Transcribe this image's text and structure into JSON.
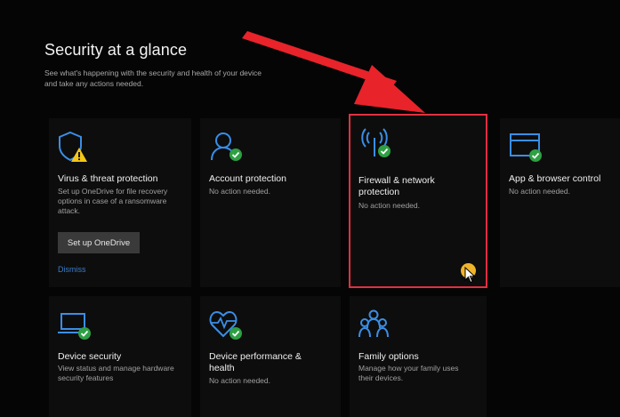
{
  "header": {
    "title": "Security at a glance",
    "subtitle_line1": "See what's happening with the security and health of your device",
    "subtitle_line2": "and take any actions needed."
  },
  "tiles": [
    {
      "icon": "shield-warning-icon",
      "title": "Virus & threat protection",
      "desc": "Set up OneDrive for file recovery options in case of a ransomware attack.",
      "button_label": "Set up OneDrive",
      "dismiss_label": "Dismiss"
    },
    {
      "icon": "account-check-icon",
      "title": "Account protection",
      "desc": "No action needed."
    },
    {
      "icon": "wifi-antenna-check-icon",
      "title": "Firewall & network protection",
      "desc": "No action needed."
    },
    {
      "icon": "browser-window-check-icon",
      "title": "App & browser control",
      "desc": "No action needed."
    },
    {
      "icon": "laptop-check-icon",
      "title": "Device security",
      "desc": "View status and manage hardware security features"
    },
    {
      "icon": "heart-pulse-check-icon",
      "title": "Device performance & health",
      "desc": "No action needed."
    },
    {
      "icon": "family-icon",
      "title": "Family options",
      "desc": "Manage how your family uses their devices."
    }
  ],
  "colors": {
    "accent": "#3a8ee6",
    "ok_green": "#2ea043",
    "warning_yellow": "#f5c518",
    "highlight_red": "#e03040",
    "arrow_red": "#e8232a"
  }
}
